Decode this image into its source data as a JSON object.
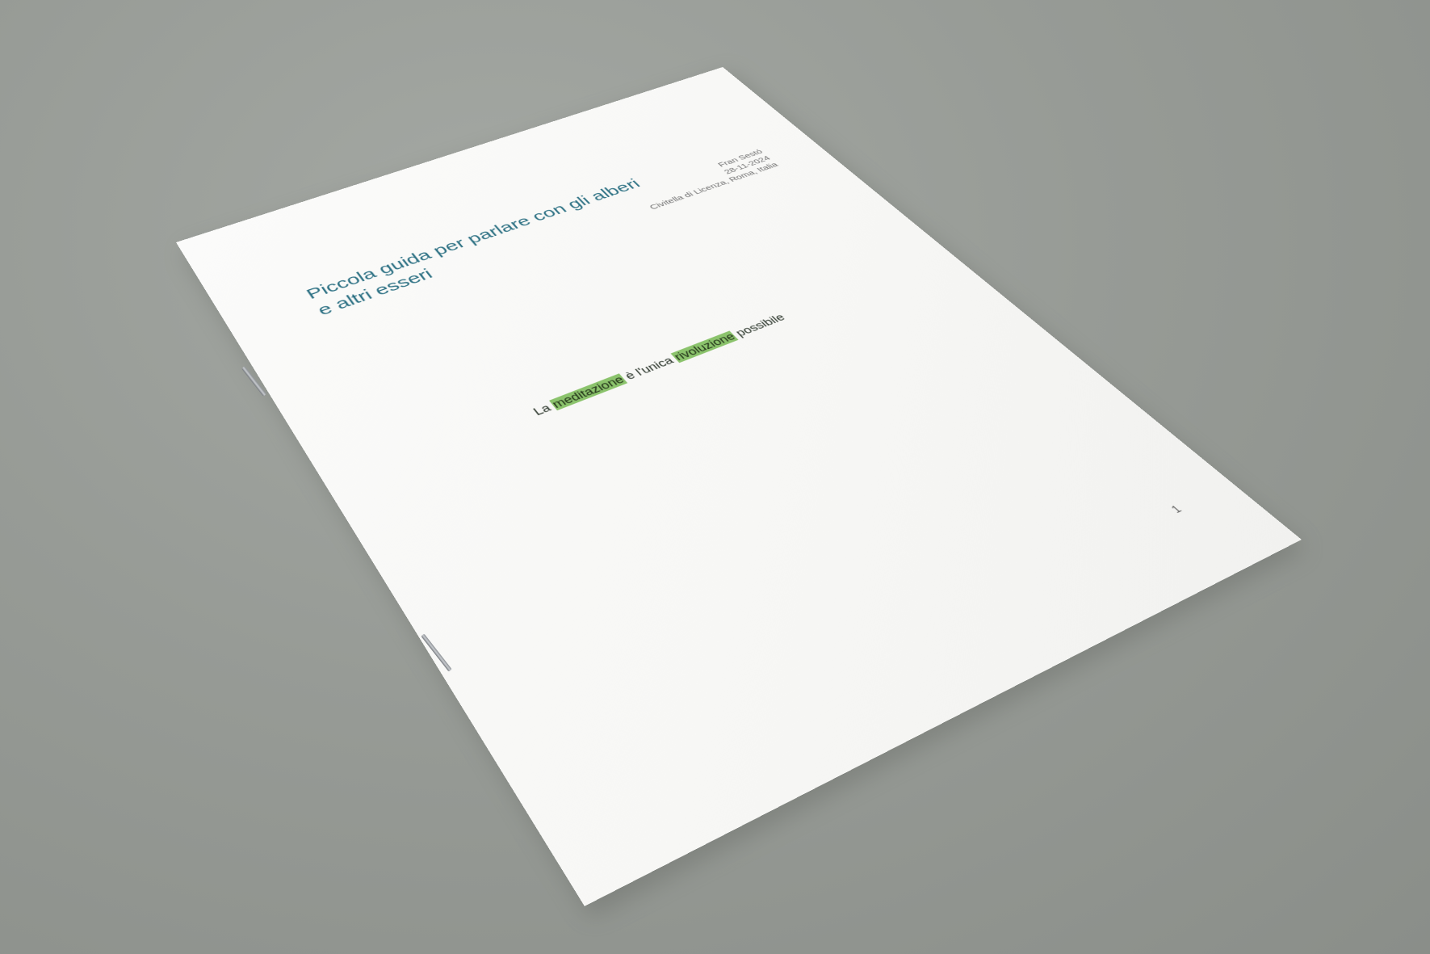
{
  "document": {
    "title_line1": "Piccola guida per parlare con gli alberi",
    "title_line2": "e altri esseri",
    "author": "Fran Sestó",
    "date": "28-11-2024",
    "location": "Civitella di Licenza, Roma, Italia",
    "quote": {
      "prefix": "La ",
      "highlight1": "meditazione",
      "middle": " è l'unica ",
      "highlight2": "rivoluzione",
      "suffix": " possibile"
    },
    "page_number": "1"
  },
  "colors": {
    "background": "#979b96",
    "paper": "#f8f8f6",
    "title": "#2a6f82",
    "highlight": "#8bc36c"
  }
}
